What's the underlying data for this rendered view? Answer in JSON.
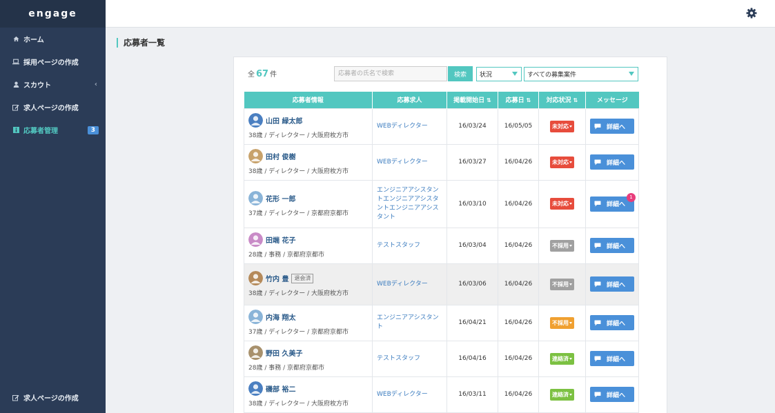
{
  "sidebar": {
    "brand": "engage",
    "items": [
      {
        "label": "ホーム"
      },
      {
        "label": "採用ページの作成"
      },
      {
        "label": "スカウト"
      },
      {
        "label": "求人ページの作成"
      },
      {
        "label": "応募者管理",
        "badge": "3"
      }
    ],
    "bottom_item": {
      "label": "求人ページの作成"
    }
  },
  "page": {
    "title": "応募者一覧"
  },
  "toolbar": {
    "count_prefix": "全",
    "count_value": "67",
    "count_suffix": "件",
    "search_placeholder": "応募者の氏名で検索",
    "search_button": "検索",
    "status_select": "状況",
    "jobs_select": "すべての募集案件"
  },
  "table": {
    "headers": [
      "応募者情報",
      "応募求人",
      "掲載開始日",
      "応募日",
      "対応状況",
      "メッセージ"
    ],
    "sort_icon": "⇅",
    "detail_label": "詳細へ",
    "rows": [
      {
        "name": "山田 緑太郎",
        "info": "38歳 / ディレクター / 大阪府枚方市",
        "job": "WEBディレクター",
        "start": "16/03/24",
        "applied": "16/05/05",
        "status": "未対応",
        "status_color": "#e74c3c"
      },
      {
        "name": "田村 俊樹",
        "info": "38歳 / ディレクター / 大阪府枚方市",
        "job": "WEBディレクター",
        "start": "16/03/27",
        "applied": "16/04/26",
        "status": "未対応",
        "status_color": "#e74c3c"
      },
      {
        "name": "花形 一郎",
        "info": "37歳 / ディレクター / 京都府京都市",
        "job": "エンジニアアシスタントエンジニアアシスタントエンジニアアシスタント",
        "start": "16/03/10",
        "applied": "16/04/26",
        "status": "未対応",
        "status_color": "#e74c3c",
        "notification": "1"
      },
      {
        "name": "田端 花子",
        "info": "28歳 / 事務 / 京都府京都市",
        "job": "テストスタッフ",
        "start": "16/03/04",
        "applied": "16/04/26",
        "status": "不採用",
        "status_color": "#a0a0a0"
      },
      {
        "name": "竹内 豊",
        "tag": "退会済",
        "info": "38歳 / ディレクター / 大阪府枚方市",
        "job": "WEBディレクター",
        "start": "16/03/06",
        "applied": "16/04/26",
        "status": "不採用",
        "status_color": "#a0a0a0"
      },
      {
        "name": "内海 翔太",
        "info": "37歳 / ディレクター / 京都府京都市",
        "job": "エンジニアアシスタント",
        "start": "16/04/21",
        "applied": "16/04/26",
        "status": "不採用",
        "status_color": "#f0a030"
      },
      {
        "name": "野田 久美子",
        "info": "28歳 / 事務 / 京都府京都市",
        "job": "テストスタッフ",
        "start": "16/04/16",
        "applied": "16/04/26",
        "status": "連絡済",
        "status_color": "#7cc142"
      },
      {
        "name": "磯部 裕二",
        "info": "38歳 / ディレクター / 大阪府枚方市",
        "job": "WEBディレクター",
        "start": "16/03/11",
        "applied": "16/04/26",
        "status": "連絡済",
        "status_color": "#7cc142"
      }
    ]
  }
}
